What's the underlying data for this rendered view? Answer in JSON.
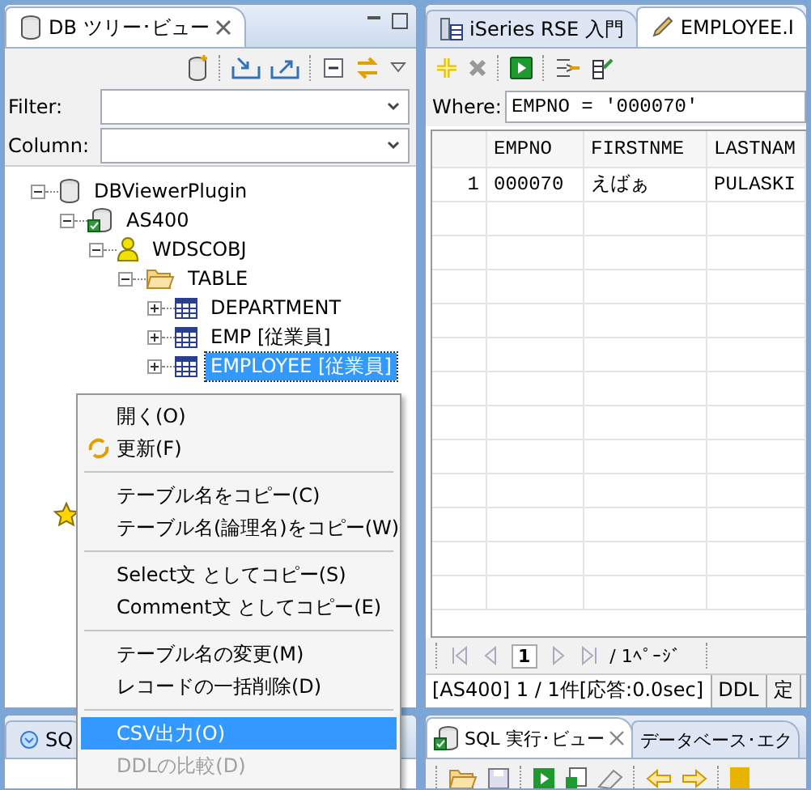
{
  "tree_view": {
    "title": "DB ツリー･ビュー",
    "filter": {
      "label": "Filter:"
    },
    "column": {
      "label": "Column:"
    },
    "tree": [
      {
        "label": "DBViewerPlugin",
        "kind": "database",
        "expanded": true,
        "selected": false,
        "children": [
          {
            "label": "AS400",
            "kind": "connection",
            "expanded": true,
            "selected": false,
            "children": [
              {
                "label": "WDSCOBJ",
                "kind": "schema",
                "expanded": true,
                "selected": false,
                "children": [
                  {
                    "label": "TABLE",
                    "kind": "folder",
                    "expanded": true,
                    "selected": false,
                    "children": [
                      {
                        "label": "DEPARTMENT",
                        "kind": "table",
                        "expanded": false,
                        "selected": false
                      },
                      {
                        "label": "EMP [従業員]",
                        "kind": "table",
                        "expanded": false,
                        "selected": false
                      },
                      {
                        "label": "EMPLOYEE [従業員]",
                        "kind": "table",
                        "expanded": false,
                        "selected": true
                      }
                    ]
                  }
                ]
              }
            ]
          },
          {
            "kind": "favorite",
            "selected": false
          }
        ]
      }
    ],
    "bottom_tab": {
      "label": "SQ"
    }
  },
  "editor": {
    "tabs": [
      {
        "label": "iSeries RSE 入門",
        "kind": "intro",
        "selected": false
      },
      {
        "label": "EMPLOYEE.I",
        "kind": "edit",
        "selected": true
      }
    ],
    "where": {
      "label": "Where:",
      "value": "EMPNO = '000070'"
    },
    "table": {
      "columns": [
        "EMPNO",
        "FIRSTNME",
        "LASTNAM"
      ],
      "rows": [
        {
          "number": "1",
          "cells": [
            "000070",
            "えばぁ",
            "PULASKI"
          ]
        }
      ]
    },
    "pager": {
      "page": "1",
      "total": "/ 1ﾍﾟｰｼﾞ"
    },
    "result_tabs": [
      {
        "label": "[AS400] 1 / 1件[応答:0.0sec]",
        "selected": true
      },
      {
        "label": "DDL",
        "selected": false
      },
      {
        "label": "定",
        "selected": false
      }
    ]
  },
  "sql_view": {
    "tabs": [
      {
        "label": "SQL 実行･ビュー",
        "selected": true
      },
      {
        "label": "データベース･エク",
        "selected": false
      }
    ]
  },
  "context_menu": [
    {
      "kind": "item",
      "label": "開く(O)",
      "disabled": false,
      "selected": false
    },
    {
      "kind": "refresh",
      "label": "更新(F)",
      "disabled": false,
      "selected": false
    },
    {
      "kind": "separator"
    },
    {
      "kind": "item",
      "label": "テーブル名をコピー(C)",
      "disabled": false,
      "selected": false
    },
    {
      "kind": "item",
      "label": "テーブル名(論理名)をコピー(W)",
      "disabled": false,
      "selected": false
    },
    {
      "kind": "separator"
    },
    {
      "kind": "item",
      "label": "Select文 としてコピー(S)",
      "disabled": false,
      "selected": false
    },
    {
      "kind": "item",
      "label": "Comment文 としてコピー(E)",
      "disabled": false,
      "selected": false
    },
    {
      "kind": "separator"
    },
    {
      "kind": "item",
      "label": "テーブル名の変更(M)",
      "disabled": false,
      "selected": false
    },
    {
      "kind": "item",
      "label": "レコードの一括削除(D)",
      "disabled": false,
      "selected": false
    },
    {
      "kind": "separator"
    },
    {
      "kind": "item",
      "label": "CSV出力(O)",
      "disabled": false,
      "selected": true
    },
    {
      "kind": "item",
      "label": "DDLの比較(D)",
      "disabled": true,
      "selected": false
    }
  ]
}
